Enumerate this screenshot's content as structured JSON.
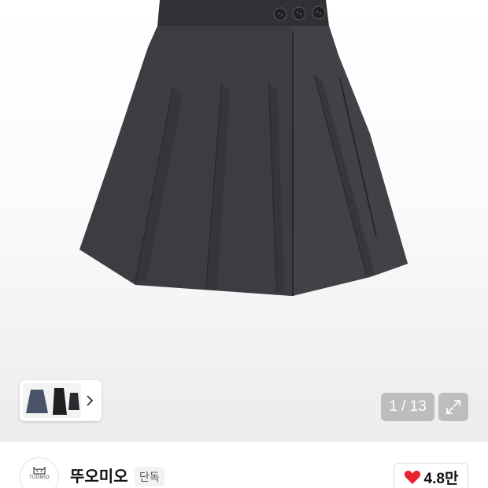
{
  "gallery": {
    "thumbnail_icon": "chevron-right-icon",
    "page_counter": "1 / 13",
    "expand_icon": "expand-arrows-icon"
  },
  "brand": {
    "logo_text": "TUOMIO",
    "name": "뚜오미오",
    "badge": "단독"
  },
  "like": {
    "icon": "heart-icon",
    "count": "4.8만",
    "color": "#e8222e"
  }
}
